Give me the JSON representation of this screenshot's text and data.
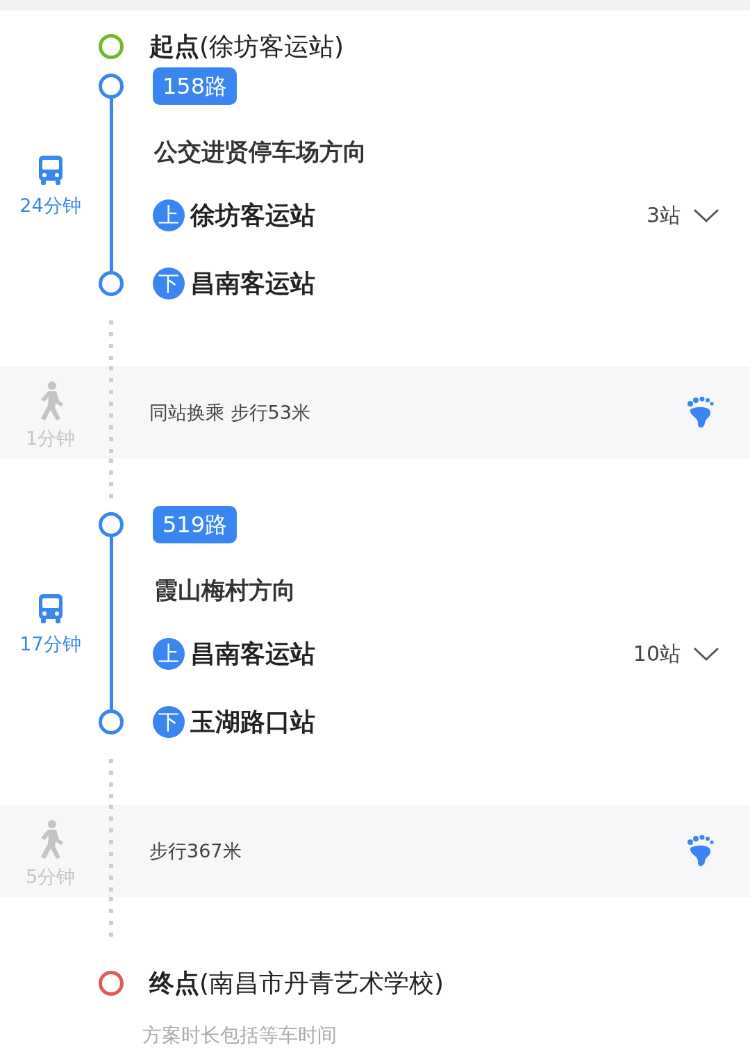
{
  "start": {
    "label": "**起点**(徐坊客运站)"
  },
  "segments": [
    {
      "kind": "bus",
      "duration": "24分钟",
      "route": "158路",
      "direction": "公交进贤停车场方向",
      "board": {
        "badge": "上",
        "stop": "徐坊客运站"
      },
      "stop_count": "3站",
      "alight": {
        "badge": "下",
        "stop": "昌南客运站"
      }
    },
    {
      "kind": "walk",
      "duration": "1分钟",
      "text": "同站换乘 步行53米"
    },
    {
      "kind": "bus",
      "duration": "17分钟",
      "route": "519路",
      "direction": "霞山梅村方向",
      "board": {
        "badge": "上",
        "stop": "昌南客运站"
      },
      "stop_count": "10站",
      "alight": {
        "badge": "下",
        "stop": "玉湖路口站"
      }
    },
    {
      "kind": "walk",
      "duration": "5分钟",
      "text": "步行367米"
    }
  ],
  "end": {
    "label": "**终点**(南昌市丹青艺术学校)"
  },
  "footnote": "方案时长包括等车时间"
}
